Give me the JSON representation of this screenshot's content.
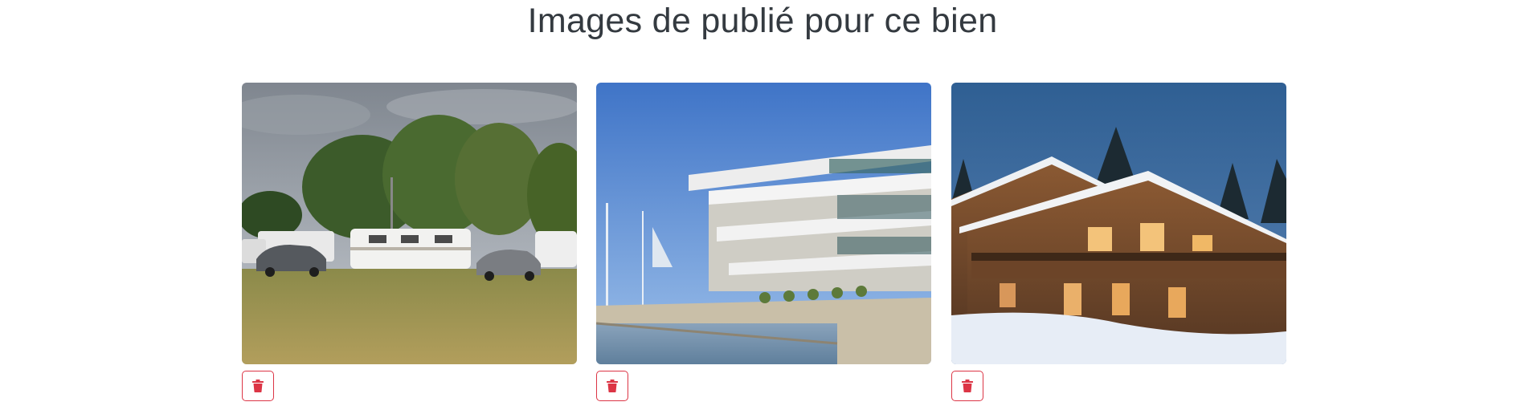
{
  "page_title": "Images de publié pour ce bien",
  "accent_color": "#dc3545",
  "images": [
    {
      "subject": "campsite-caravans-photo",
      "delete_icon": "trash-icon"
    },
    {
      "subject": "modern-waterfront-building-photo",
      "delete_icon": "trash-icon"
    },
    {
      "subject": "snowy-wooden-chalet-photo",
      "delete_icon": "trash-icon"
    }
  ]
}
